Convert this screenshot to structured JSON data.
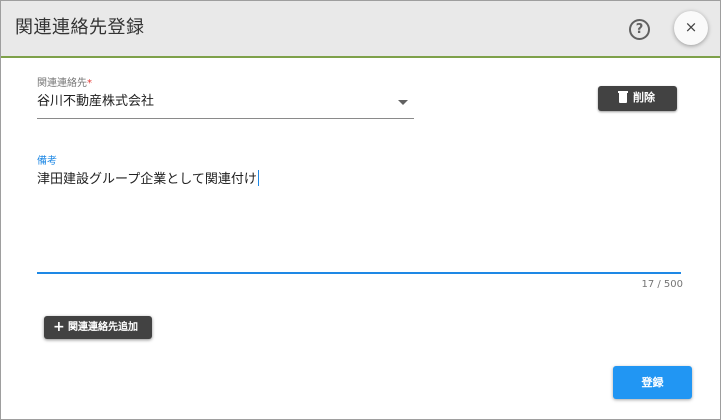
{
  "dialog": {
    "title": "関連連絡先登録",
    "help_icon_glyph": "?",
    "close_glyph": "×"
  },
  "contact_field": {
    "label": "関連連絡先",
    "required_mark": "*",
    "value": "谷川不動産株式会社"
  },
  "delete_button": {
    "label": "削除",
    "icon": "trash-icon"
  },
  "memo_field": {
    "label": "備考",
    "value": "津田建設グループ企業として関連付け",
    "counter": "17 / 500"
  },
  "add_button": {
    "icon_glyph": "+",
    "label": "関連連絡先追加"
  },
  "register_button": {
    "label": "登録"
  },
  "colors": {
    "header_bg": "#e9e9e9",
    "header_accent": "#7ea14a",
    "primary": "#2196f3",
    "dark_button": "#424242",
    "required": "#e53935"
  }
}
